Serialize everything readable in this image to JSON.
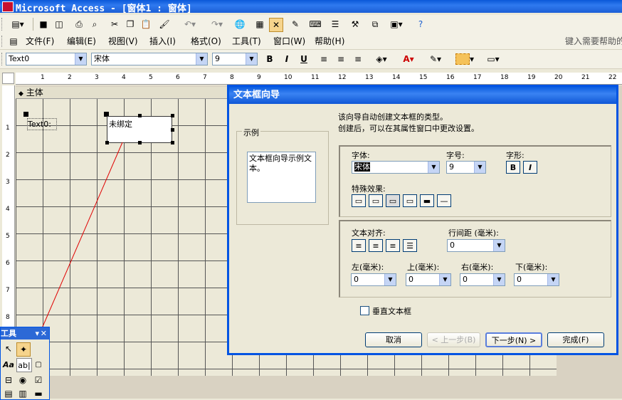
{
  "window": {
    "title": "Microsoft Access - [窗体1 : 窗体]"
  },
  "menu": {
    "items": [
      "文件(F)",
      "编辑(E)",
      "视图(V)",
      "插入(I)",
      "格式(O)",
      "工具(T)",
      "窗口(W)",
      "帮助(H)"
    ],
    "help_placeholder": "键入需要帮助的"
  },
  "format_toolbar": {
    "object": "Text0",
    "font": "宋体",
    "size": "9"
  },
  "ruler": {
    "numbers": [
      "1",
      "2",
      "3",
      "4",
      "5",
      "6",
      "7",
      "8",
      "9",
      "10",
      "11",
      "12",
      "13",
      "14",
      "15",
      "16",
      "17",
      "18",
      "19",
      "20",
      "21",
      "22"
    ]
  },
  "form": {
    "section_label": "主体",
    "label_control": "Text0:",
    "textbox_control": "未绑定",
    "vruler_numbers": [
      "1",
      "2",
      "3",
      "4",
      "5",
      "6",
      "7",
      "8"
    ]
  },
  "wizard": {
    "title": "文本框向导",
    "intro_line1": "该向导自动创建文本框的类型。",
    "intro_line2": "创建后，可以在其属性窗口中更改设置。",
    "sample_group": "示例",
    "sample_text": "文本框向导示例文本。",
    "font_label": "字体:",
    "font_value": "宋体",
    "size_label": "字号:",
    "size_value": "9",
    "style_label": "字形:",
    "bold": "B",
    "italic": "I",
    "effects_label": "特殊效果:",
    "align_label": "文本对齐:",
    "spacing_label": "行间距 (毫米):",
    "spacing_value": "0",
    "left_label": "左(毫米):",
    "top_label": "上(毫米):",
    "right_label": "右(毫米):",
    "bottom_label": "下(毫米):",
    "left_value": "0",
    "top_value": "0",
    "right_value": "0",
    "bottom_value": "0",
    "vertical_label": "垂直文本框",
    "cancel": "取消",
    "back": "< 上一步(B)",
    "next": "下一步(N) >",
    "finish": "完成(F)"
  },
  "toolbox": {
    "title": "工具",
    "label_tool": "Aa",
    "textbox_tool": "ab|"
  }
}
